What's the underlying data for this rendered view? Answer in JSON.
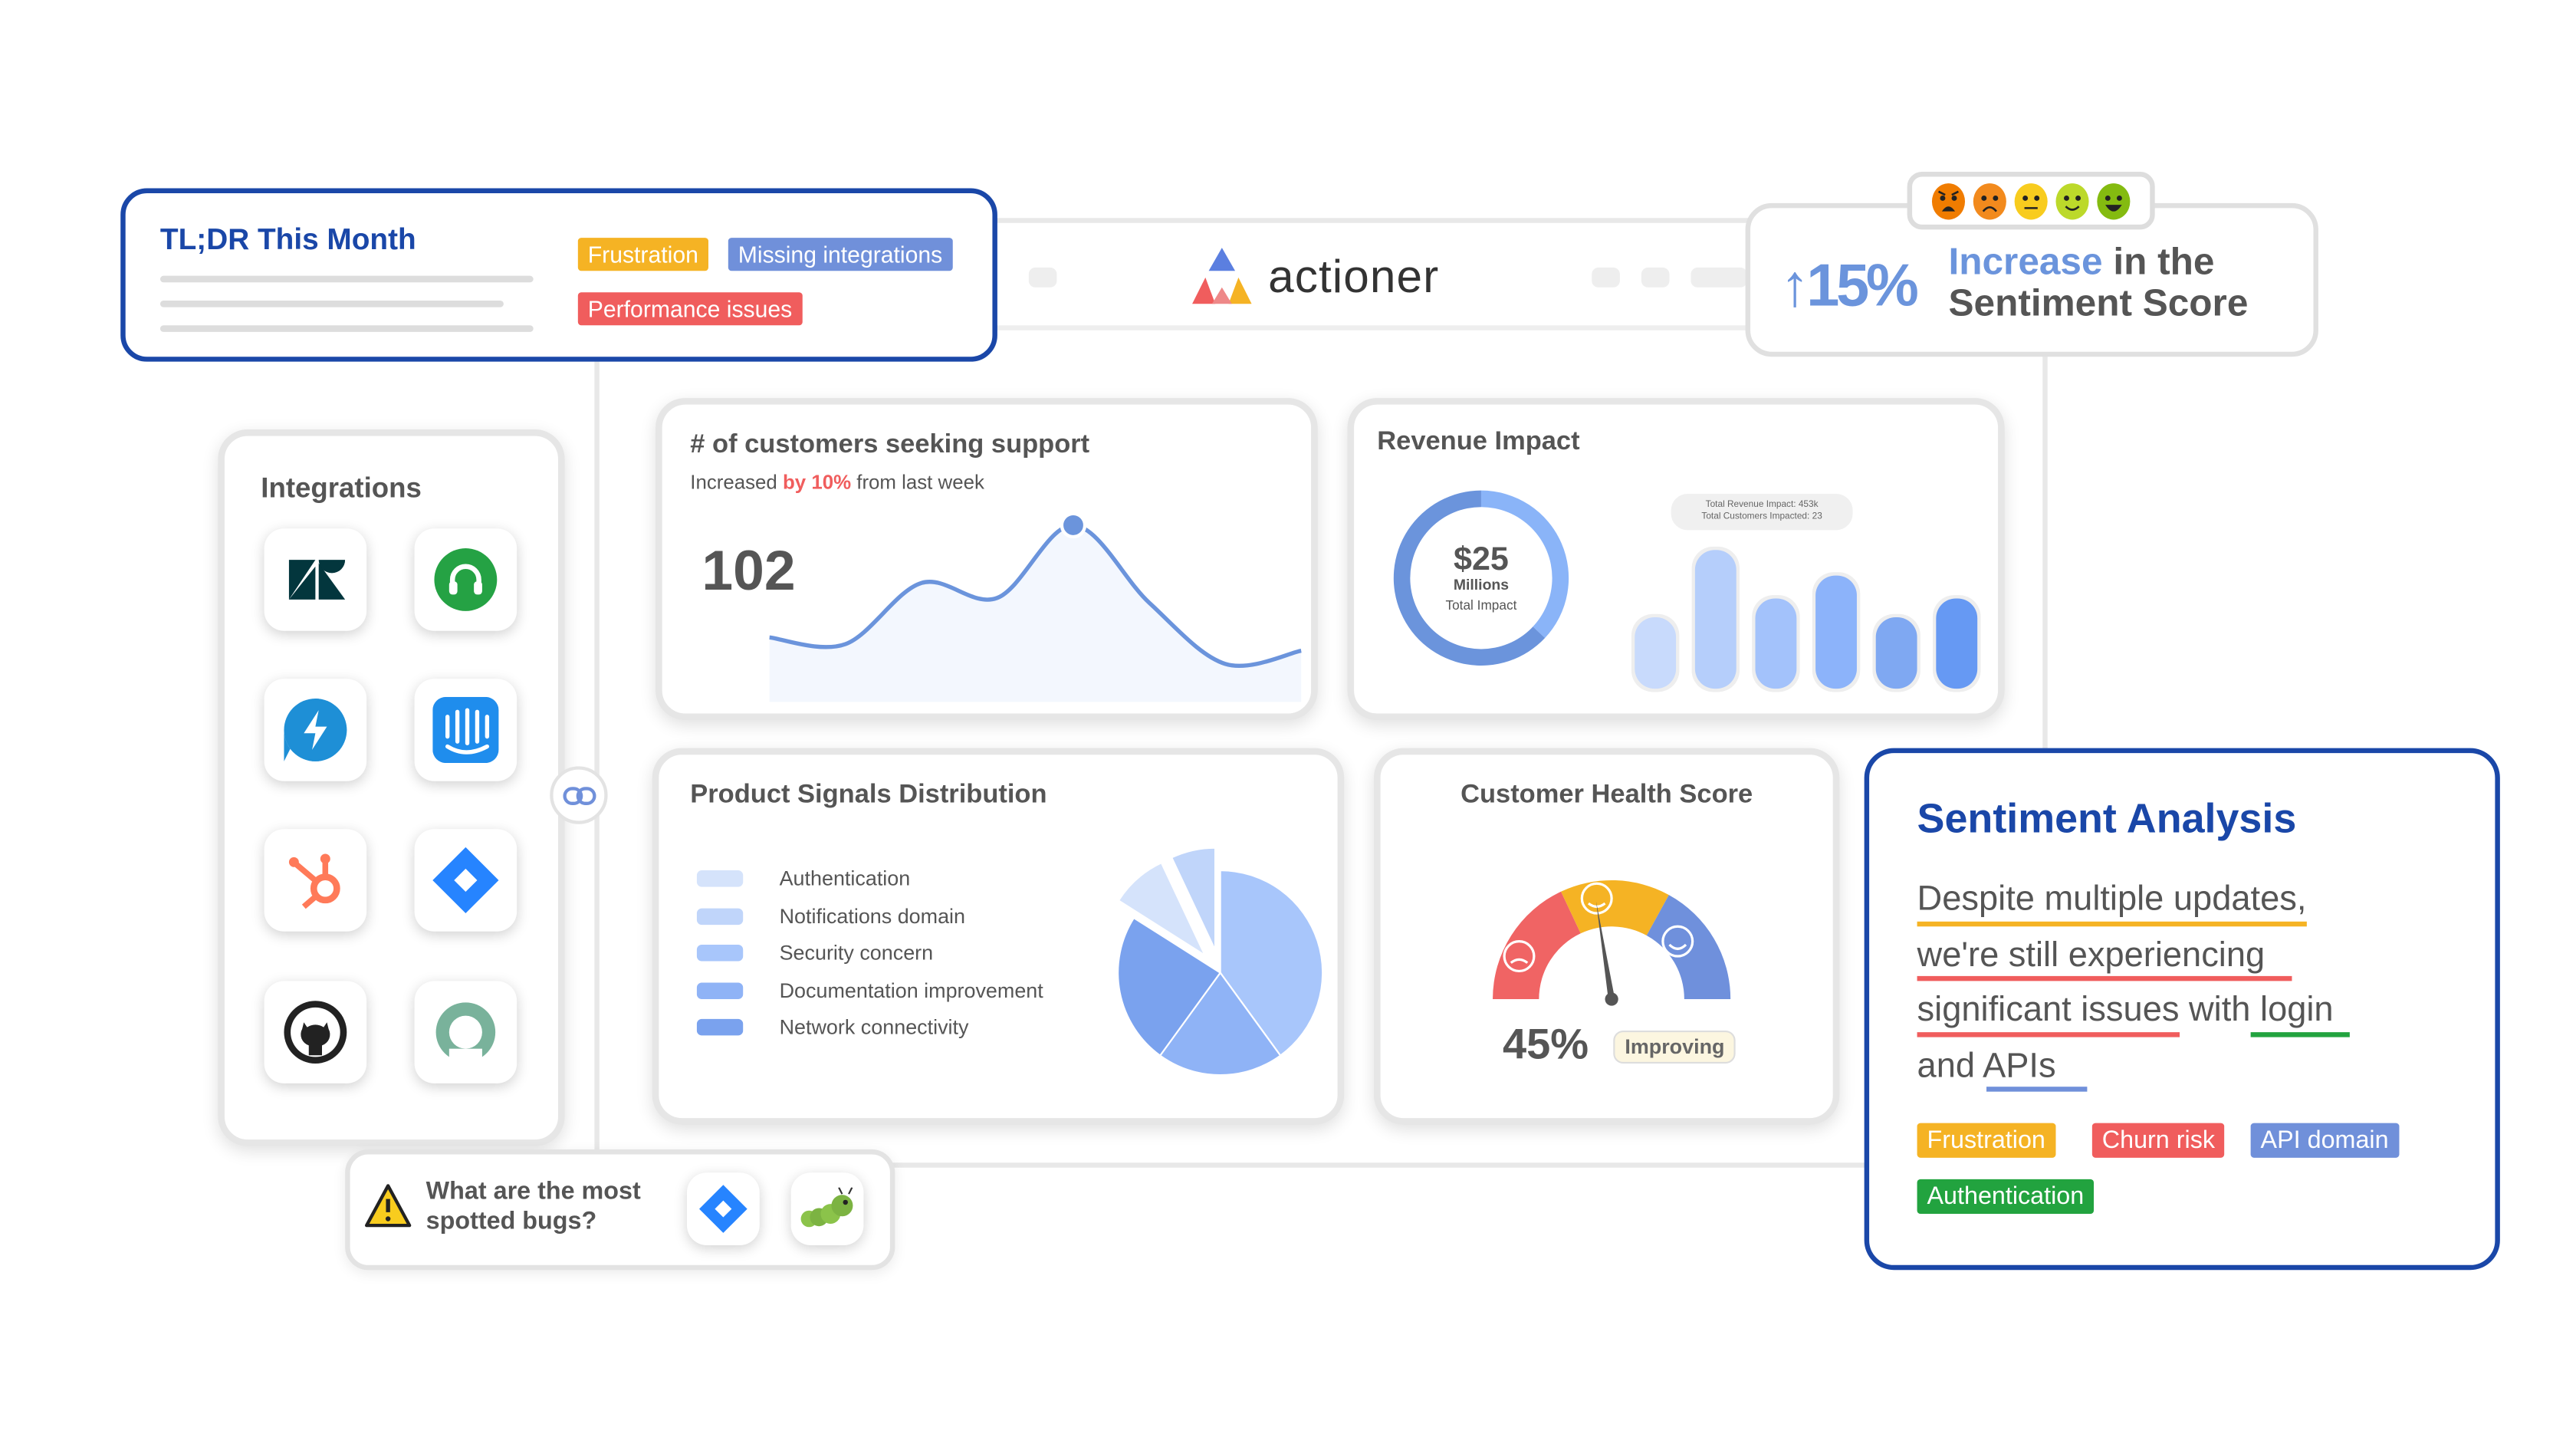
{
  "brand": {
    "name": "actioner"
  },
  "tldr": {
    "title": "TL;DR This Month",
    "tags": [
      {
        "label": "Frustration",
        "color": "#f5b324"
      },
      {
        "label": "Missing integrations",
        "color": "#7090da"
      },
      {
        "label": "Performance issues",
        "color": "#f05d5d"
      }
    ]
  },
  "sentiment_score": {
    "value": "15%",
    "arrow": "↑",
    "highlight": "Increase",
    "rest1": " in the",
    "rest2": "Sentiment Score",
    "emojis": [
      "angry",
      "sad",
      "neutral",
      "smile",
      "happy"
    ]
  },
  "integrations": {
    "title": "Integrations",
    "items": [
      "zendesk-icon",
      "freshdesk-icon",
      "zapier-bolt-icon",
      "intercom-icon",
      "hubspot-icon",
      "jira-icon",
      "github-icon",
      "front-icon"
    ]
  },
  "support_card": {
    "title": "# of customers seeking support",
    "subtitle_pre": "Increased ",
    "subtitle_hl": "by 10%",
    "subtitle_post": " from last week",
    "value": "102"
  },
  "revenue_card": {
    "title": "Revenue Impact",
    "amount": "$25",
    "unit": "Millions",
    "caption": "Total Impact",
    "tooltip_line1": "Total Revenue Impact: 453k",
    "tooltip_line2": "Total Customers Impacted: 23"
  },
  "signals_card": {
    "title": "Product Signals Distribution"
  },
  "health_card": {
    "title": "Customer Health Score",
    "value": "45%",
    "status": "Improving"
  },
  "sentiment_analysis": {
    "title": "Sentiment Analysis",
    "lines": [
      {
        "text": "Despite multiple updates,",
        "underline": "#f5b324"
      },
      {
        "text": "we're still experiencing",
        "underline": "#f05d5d"
      },
      {
        "text": "significant issues with login",
        "underline": "#f05d5d",
        "underline2": "#22a33f"
      },
      {
        "text": "and APIs",
        "underline": "#7090da"
      }
    ],
    "tags": [
      {
        "label": "Frustration",
        "color": "#f5b324"
      },
      {
        "label": "Churn risk",
        "color": "#f05d5d"
      },
      {
        "label": "API domain",
        "color": "#7090da"
      },
      {
        "label": "Authentication",
        "color": "#22a33f"
      }
    ]
  },
  "bugs": {
    "question": "What are the most spotted bugs?"
  },
  "chart_data": [
    {
      "type": "area",
      "name": "support-trend",
      "values": [
        39,
        35,
        72,
        63,
        107,
        60,
        23,
        31
      ],
      "highlight_index": 4,
      "color": "#6b94dc"
    },
    {
      "type": "pie",
      "name": "revenue-donut",
      "values": [
        37,
        63
      ],
      "colors": [
        "#8ab4f8",
        "#6b94dc"
      ]
    },
    {
      "type": "bar",
      "name": "revenue-bars",
      "values": [
        53,
        103,
        67,
        84,
        53,
        67
      ],
      "colors": [
        "#c8dafc",
        "#b5cefb",
        "#a3c2fb",
        "#8cb3fa",
        "#7fa8f2",
        "#6699f3"
      ]
    },
    {
      "type": "pie",
      "name": "product-signals",
      "categories": [
        "Authentication",
        "Notifications domain",
        "Security concern",
        "Documentation improvement",
        "Network connectivity"
      ],
      "values": [
        9,
        7,
        40,
        20,
        24
      ],
      "colors": [
        "#d5e3fb",
        "#c0d5fa",
        "#a8c6fb",
        "#8fb3f6",
        "#7aa2ee"
      ],
      "legend": "left"
    },
    {
      "type": "gauge",
      "name": "customer-health",
      "value": 45,
      "segments": [
        "#f06464",
        "#f5b324",
        "#6f90dc"
      ]
    }
  ]
}
